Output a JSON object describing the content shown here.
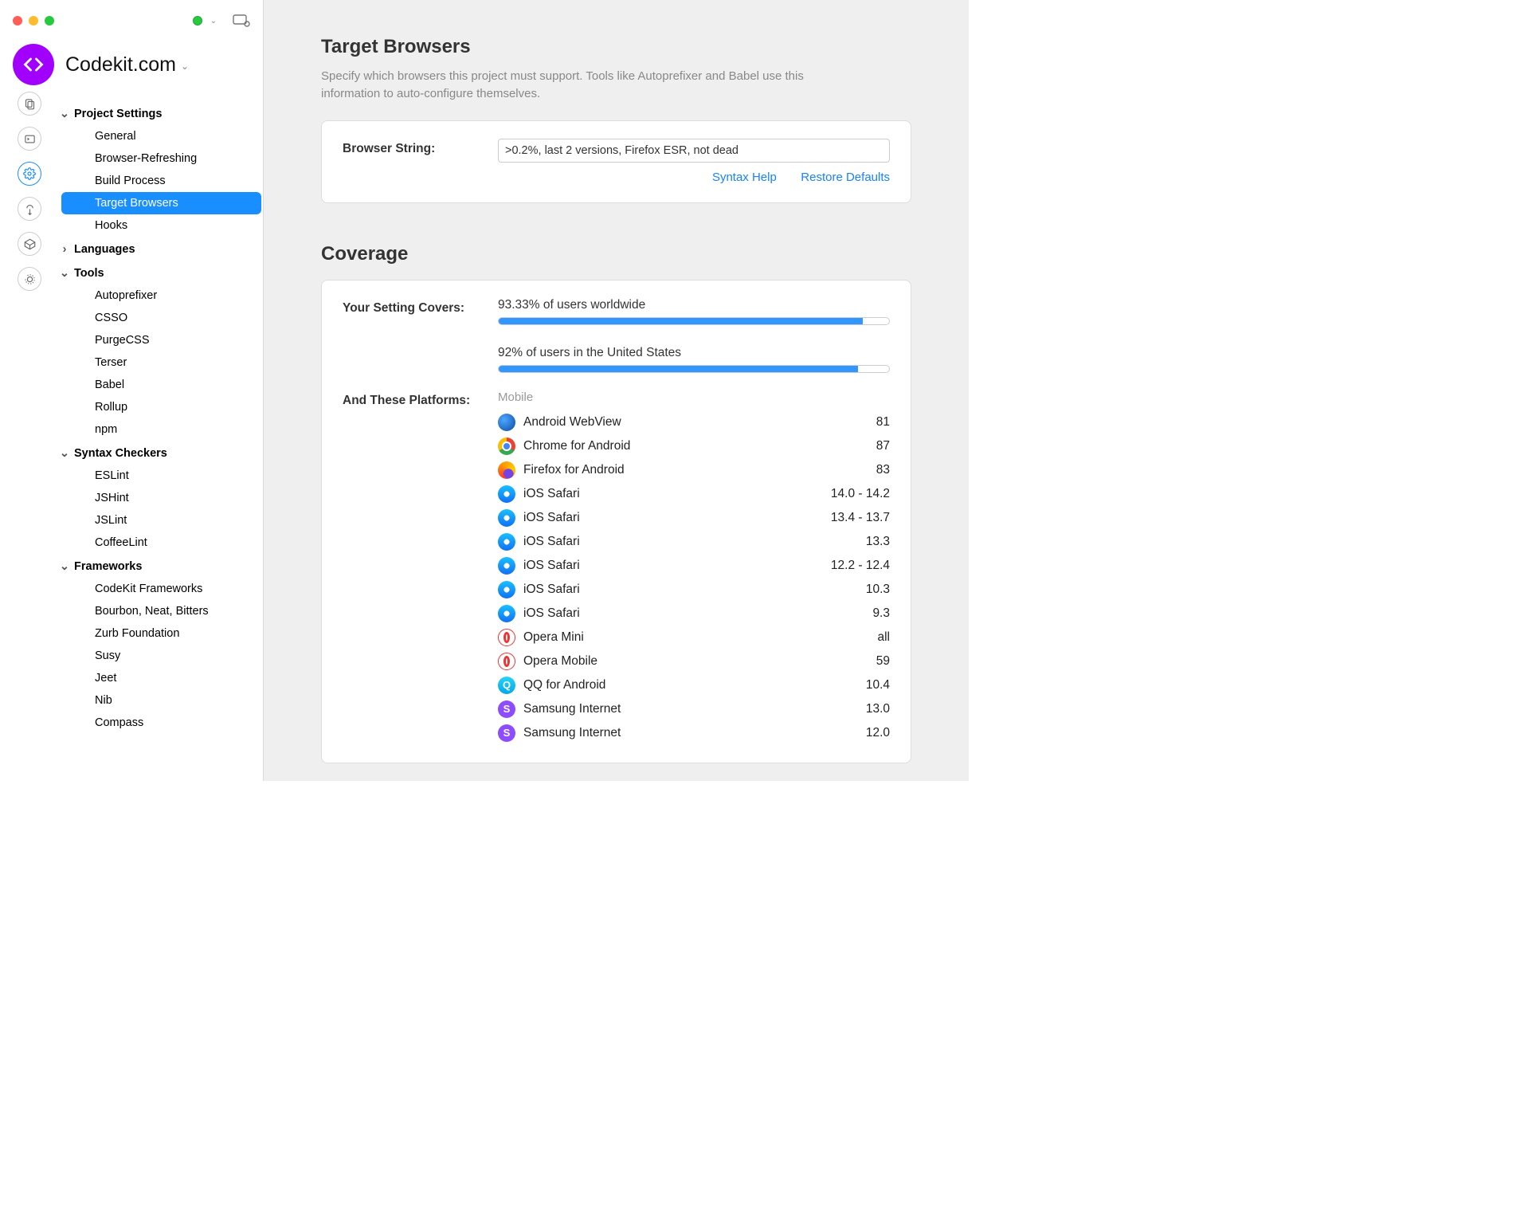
{
  "titlebar": {
    "project_name": "Codekit.com"
  },
  "sidebar": {
    "sections": [
      {
        "title": "Project Settings",
        "expanded": true,
        "items": [
          "General",
          "Browser-Refreshing",
          "Build Process",
          "Target Browsers",
          "Hooks"
        ],
        "active": 3
      },
      {
        "title": "Languages",
        "expanded": false,
        "items": []
      },
      {
        "title": "Tools",
        "expanded": true,
        "items": [
          "Autoprefixer",
          "CSSO",
          "PurgeCSS",
          "Terser",
          "Babel",
          "Rollup",
          "npm"
        ]
      },
      {
        "title": "Syntax Checkers",
        "expanded": true,
        "items": [
          "ESLint",
          "JSHint",
          "JSLint",
          "CoffeeLint"
        ]
      },
      {
        "title": "Frameworks",
        "expanded": true,
        "items": [
          "CodeKit Frameworks",
          "Bourbon, Neat, Bitters",
          "Zurb Foundation",
          "Susy",
          "Jeet",
          "Nib",
          "Compass"
        ]
      }
    ]
  },
  "main": {
    "heading": "Target Browsers",
    "subtitle": "Specify which browsers this project must support. Tools like Autoprefixer and Babel use this information to auto-configure themselves.",
    "browser_string_label": "Browser String:",
    "browser_string_value": ">0.2%, last 2 versions, Firefox ESR, not dead",
    "syntax_help": "Syntax Help",
    "restore_defaults": "Restore Defaults",
    "coverage_heading": "Coverage",
    "covers_label": "Your Setting Covers:",
    "covers_world_text": "93.33% of users worldwide",
    "covers_world_pct": 93.33,
    "covers_us_text": "92% of users in the United States",
    "covers_us_pct": 92,
    "platforms_label": "And These Platforms:",
    "mobile_header": "Mobile",
    "platforms": [
      {
        "icon": "android",
        "name": "Android WebView",
        "ver": "81"
      },
      {
        "icon": "chrome",
        "name": "Chrome for Android",
        "ver": "87"
      },
      {
        "icon": "firefox",
        "name": "Firefox for Android",
        "ver": "83"
      },
      {
        "icon": "safari",
        "name": "iOS Safari",
        "ver": "14.0 - 14.2"
      },
      {
        "icon": "safari",
        "name": "iOS Safari",
        "ver": "13.4 - 13.7"
      },
      {
        "icon": "safari",
        "name": "iOS Safari",
        "ver": "13.3"
      },
      {
        "icon": "safari",
        "name": "iOS Safari",
        "ver": "12.2 - 12.4"
      },
      {
        "icon": "safari",
        "name": "iOS Safari",
        "ver": "10.3"
      },
      {
        "icon": "safari",
        "name": "iOS Safari",
        "ver": "9.3"
      },
      {
        "icon": "opera",
        "name": "Opera Mini",
        "ver": "all"
      },
      {
        "icon": "opera",
        "name": "Opera Mobile",
        "ver": "59"
      },
      {
        "icon": "qq",
        "name": "QQ for Android",
        "ver": "10.4"
      },
      {
        "icon": "samsung",
        "name": "Samsung Internet",
        "ver": "13.0"
      },
      {
        "icon": "samsung",
        "name": "Samsung Internet",
        "ver": "12.0"
      }
    ]
  }
}
